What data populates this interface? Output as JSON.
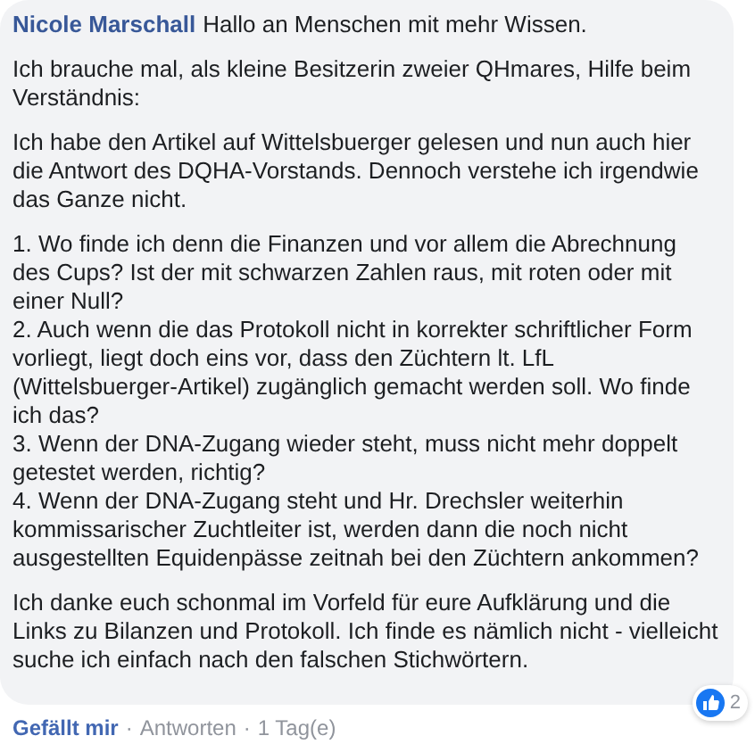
{
  "comment": {
    "author": "Nicole Marschall",
    "paragraphs": [
      {
        "lines": [
          "Hallo an Menschen mit mehr Wissen."
        ]
      },
      {
        "lines": [
          "Ich brauche mal, als kleine Besitzerin zweier QHmares, Hilfe beim Verständnis:"
        ]
      },
      {
        "lines": [
          "Ich habe den Artikel auf Wittelsbuerger gelesen und nun auch hier die Antwort des DQHA-Vorstands. Dennoch verstehe ich irgendwie das Ganze nicht."
        ]
      },
      {
        "lines": [
          "1. Wo finde ich denn die Finanzen und vor allem die Abrechnung des Cups? Ist der mit schwarzen Zahlen raus, mit roten oder mit einer Null?",
          "2. Auch wenn die das Protokoll nicht in korrekter schriftlicher Form vorliegt, liegt doch eins vor, dass den Züchtern lt. LfL (Wittelsbuerger-Artikel) zugänglich gemacht werden soll. Wo finde ich das?",
          "3. Wenn der DNA-Zugang wieder steht, muss nicht mehr doppelt getestet werden, richtig?",
          "4. Wenn der DNA-Zugang steht und Hr. Drechsler weiterhin kommissarischer Zuchtleiter ist, werden dann die noch nicht ausgestellten Equidenpässe zeitnah bei den Züchtern ankommen?"
        ]
      },
      {
        "lines": [
          "Ich danke euch schonmal im Vorfeld für eure Aufklärung und die Links zu Bilanzen und Protokoll. Ich finde es nämlich nicht - vielleicht suche ich einfach nach den falschen Stichwörtern."
        ]
      }
    ],
    "reactions": {
      "count": "2"
    },
    "actions": [
      {
        "label": "Gefällt mir",
        "kind": "like"
      },
      {
        "label": "·",
        "kind": "separator"
      },
      {
        "label": "Antworten",
        "kind": "reply"
      },
      {
        "label": "·",
        "kind": "separator"
      },
      {
        "label": "1 Tag(e)",
        "kind": "time"
      }
    ]
  }
}
